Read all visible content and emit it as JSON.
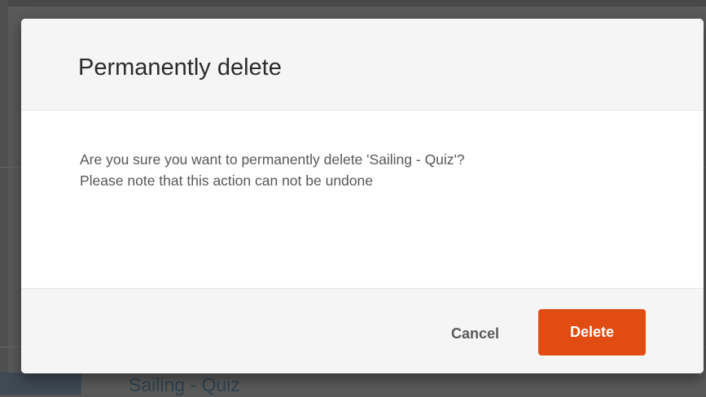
{
  "dialog": {
    "title": "Permanently delete",
    "message_line1": "Are you sure you want to permanently delete 'Sailing - Quiz'?",
    "message_line2": "Please note that this action can not be undone",
    "cancel_label": "Cancel",
    "delete_label": "Delete"
  },
  "background": {
    "item_title": "Sailing - Quiz"
  },
  "colors": {
    "delete_button": "#e14c12",
    "overlay": "#565656"
  }
}
